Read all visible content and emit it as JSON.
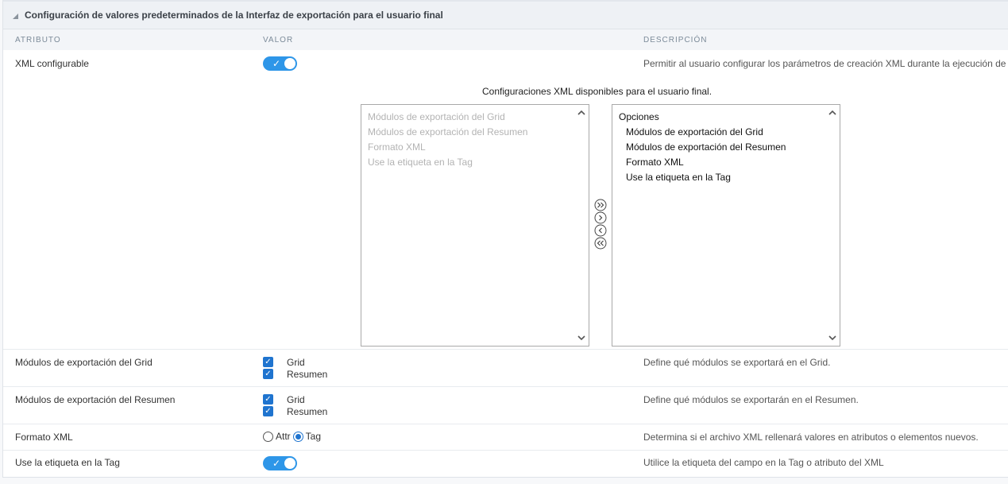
{
  "section": {
    "title": "Configuración de valores predeterminados de la Interfaz de exportación para el usuario final"
  },
  "columns": {
    "attribute": "ATRIBUTO",
    "value": "VALOR",
    "description": "DESCRIPCIÓN"
  },
  "rows": {
    "xml_configurable": {
      "label": "XML configurable",
      "toggle_on": true,
      "description": "Permitir al usuario configurar los parámetros de creación XML durante la ejecución de la aplicación."
    },
    "xml_lists": {
      "caption": "Configuraciones XML disponibles para el usuario final.",
      "available": [
        "Módulos de exportación del Grid",
        "Módulos de exportación del Resumen",
        "Formato XML",
        "Use la etiqueta en la Tag"
      ],
      "selected_header": "Opciones",
      "selected": [
        "Módulos de exportación del Grid",
        "Módulos de exportación del Resumen",
        "Formato XML",
        "Use la etiqueta en la Tag"
      ]
    },
    "grid_modules": {
      "label": "Módulos de exportación del Grid",
      "options": [
        "Grid",
        "Resumen"
      ],
      "checked": [
        true,
        true
      ],
      "description": "Define qué módulos se exportará en el Grid."
    },
    "summary_modules": {
      "label": "Módulos de exportación del Resumen",
      "options": [
        "Grid",
        "Resumen"
      ],
      "checked": [
        true,
        true
      ],
      "description": "Define qué módulos se exportarán en el Resumen."
    },
    "xml_format": {
      "label": "Formato XML",
      "options": [
        "Attr",
        "Tag"
      ],
      "selected": "Tag",
      "description": "Determina si el archivo XML rellenará valores en atributos o elementos nuevos."
    },
    "tag_label": {
      "label": "Use la etiqueta en la Tag",
      "toggle_on": true,
      "description": "Utilice la etiqueta del campo en la Tag o atributo del XML"
    }
  },
  "colors": {
    "accent": "#2e96e8",
    "checkbox": "#1f74cf",
    "header_bg": "#eef1f5"
  }
}
